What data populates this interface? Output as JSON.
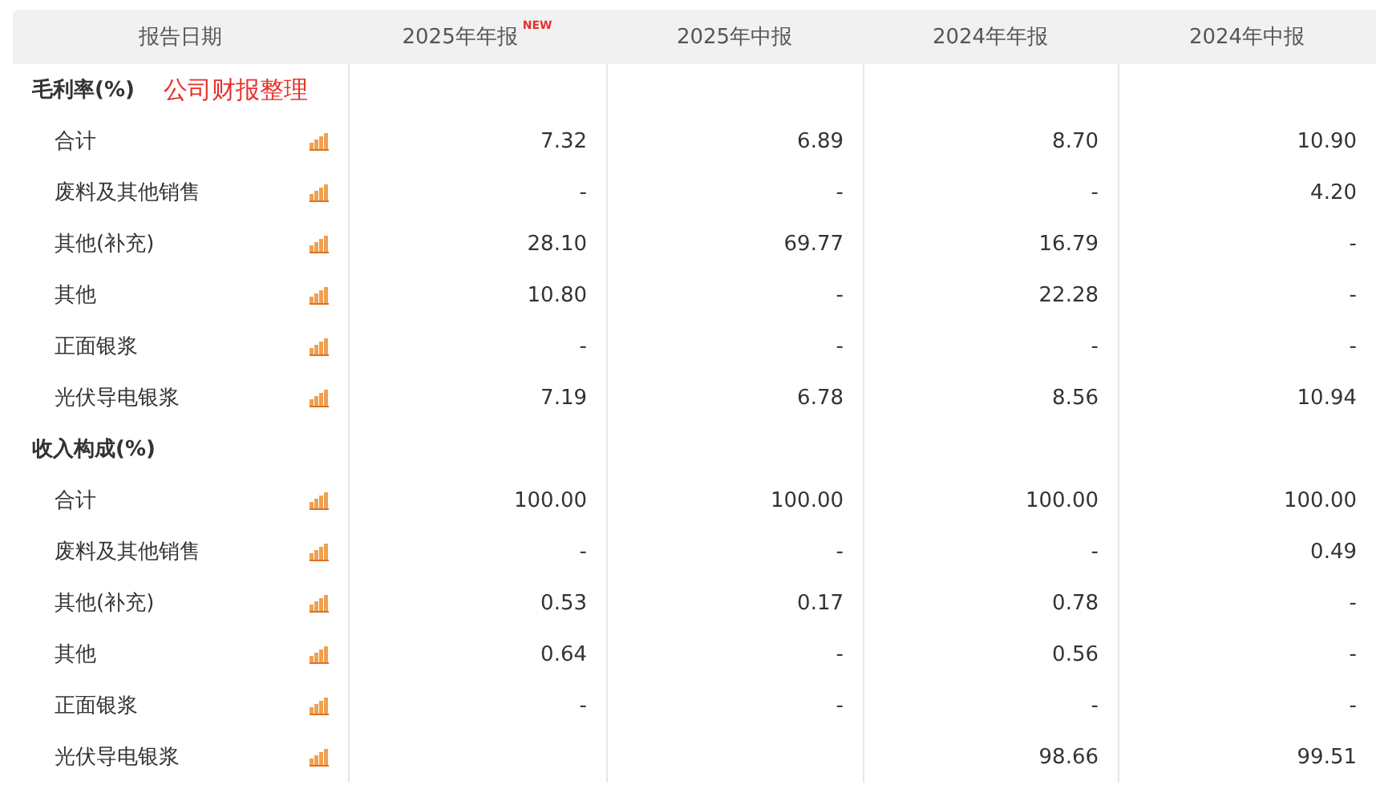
{
  "table": {
    "columns": [
      {
        "label": "报告日期"
      },
      {
        "label": "2025年年报",
        "badge": "NEW"
      },
      {
        "label": "2025年中报"
      },
      {
        "label": "2024年年报"
      },
      {
        "label": "2024年中报"
      }
    ],
    "sections": [
      {
        "title": "毛利率(%)",
        "note": "公司财报整理",
        "rows": [
          {
            "label": "合计",
            "cells": {
              "col_1": "7.32",
              "col_2": "6.89",
              "col_3": "8.70",
              "col_4": "10.90"
            }
          },
          {
            "label": "废料及其他销售",
            "cells": {
              "col_1": "-",
              "col_2": "-",
              "col_3": "-",
              "col_4": "4.20"
            }
          },
          {
            "label": "其他(补充)",
            "cells": {
              "col_1": "28.10",
              "col_2": "69.77",
              "col_3": "16.79",
              "col_4": "-"
            }
          },
          {
            "label": "其他",
            "cells": {
              "col_1": "10.80",
              "col_2": "-",
              "col_3": "22.28",
              "col_4": "-"
            }
          },
          {
            "label": "正面银浆",
            "cells": {
              "col_1": "-",
              "col_2": "-",
              "col_3": "-",
              "col_4": "-"
            }
          },
          {
            "label": "光伏导电银浆",
            "cells": {
              "col_1": "7.19",
              "col_2": "6.78",
              "col_3": "8.56",
              "col_4": "10.94"
            }
          }
        ]
      },
      {
        "title": "收入构成(%)",
        "rows": [
          {
            "label": "合计",
            "cells": {
              "col_1": "100.00",
              "col_2": "100.00",
              "col_3": "100.00",
              "col_4": "100.00"
            }
          },
          {
            "label": "废料及其他销售",
            "cells": {
              "col_1": "-",
              "col_2": "-",
              "col_3": "-",
              "col_4": "0.49"
            }
          },
          {
            "label": "其他(补充)",
            "cells": {
              "col_1": "0.53",
              "col_2": "0.17",
              "col_3": "0.78",
              "col_4": "-"
            }
          },
          {
            "label": "其他",
            "cells": {
              "col_1": "0.64",
              "col_2": "-",
              "col_3": "0.56",
              "col_4": "-"
            }
          },
          {
            "label": "正面银浆",
            "cells": {
              "col_1": "-",
              "col_2": "-",
              "col_3": "-",
              "col_4": "-"
            }
          },
          {
            "label": "光伏导电银浆",
            "cells": {
              "col_3": "98.66",
              "col_4": "99.51"
            }
          }
        ]
      }
    ]
  }
}
